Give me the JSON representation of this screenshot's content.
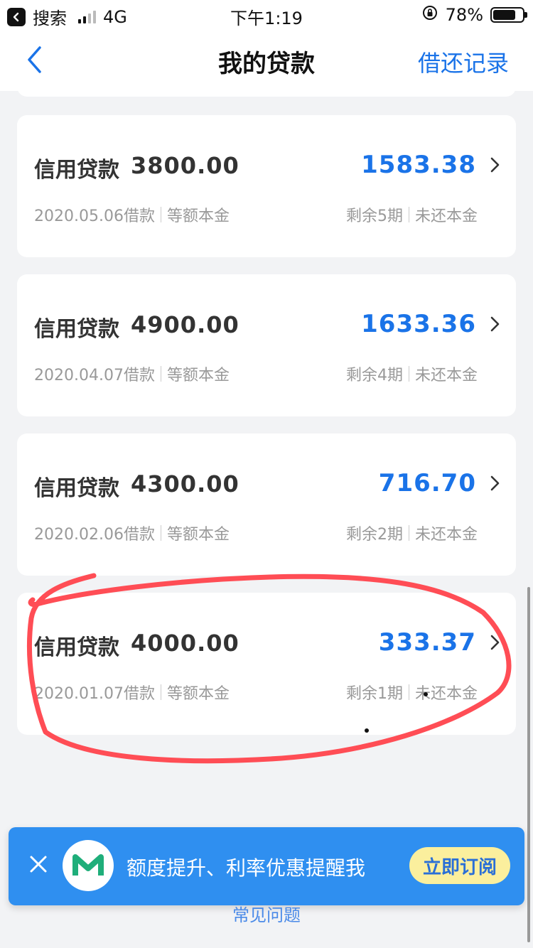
{
  "status_bar": {
    "back_app": "搜索",
    "network": "4G",
    "time": "下午1:19",
    "battery": "78%",
    "battery_level": 0.78
  },
  "nav": {
    "title": "我的贷款",
    "records": "借还记录"
  },
  "loans": [
    {
      "name": "信用贷款",
      "principal": "3800.00",
      "amount": "1583.38",
      "date": "2020.05.06借款",
      "method": "等额本金",
      "remaining": "剩余5期",
      "remaining_label": "未还本金"
    },
    {
      "name": "信用贷款",
      "principal": "4900.00",
      "amount": "1633.36",
      "date": "2020.04.07借款",
      "method": "等额本金",
      "remaining": "剩余4期",
      "remaining_label": "未还本金"
    },
    {
      "name": "信用贷款",
      "principal": "4300.00",
      "amount": "716.70",
      "date": "2020.02.06借款",
      "method": "等额本金",
      "remaining": "剩余2期",
      "remaining_label": "未还本金"
    },
    {
      "name": "信用贷款",
      "principal": "4000.00",
      "amount": "333.37",
      "date": "2020.01.07借款",
      "method": "等额本金",
      "remaining": "剩余1期",
      "remaining_label": "未还本金"
    }
  ],
  "promo": {
    "text": "额度提升、利率优惠提醒我",
    "button": "立即订阅"
  },
  "faq": "常见问题",
  "colors": {
    "accent": "#1a73e8",
    "banner": "#2f8ff0",
    "annotation": "#ff4d55"
  }
}
